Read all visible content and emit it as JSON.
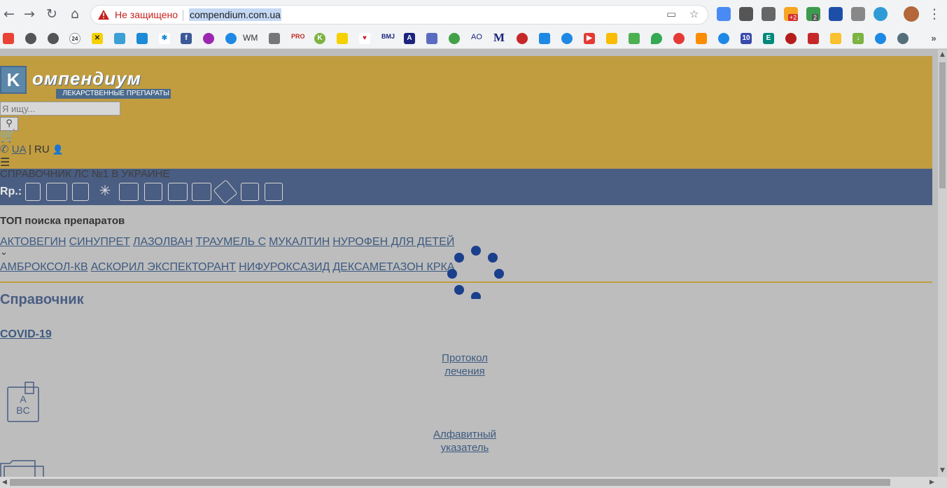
{
  "browser": {
    "not_secure_label": "Не защищено",
    "url": "compendium.com.ua",
    "bookmark_wm": "WM",
    "bookmark_pro": "PRO",
    "bookmark_bmj": "BMJ",
    "bookmark_ao": "AO",
    "bookmark_m": "M",
    "ext_badge_1": "+2",
    "ext_badge_2": "2",
    "bookmark_10": "10"
  },
  "header": {
    "logo_letter": "K",
    "logo_word": "омпендиум",
    "logo_subtitle": "ЛЕКАРСТВЕННЫЕ ПРЕПАРАТЫ",
    "search_placeholder": "Я ищу...",
    "lang_ua": "UA",
    "lang_sep": "|",
    "lang_ru": "RU",
    "tagline": "СПРАВОЧНИК ЛС №1 В УКРАИНЕ",
    "rp_label": "Rp.:"
  },
  "top_search": {
    "title": "ТОП поиска препаратов",
    "row1": [
      "АКТОВЕГИН",
      "СИНУПРЕТ",
      "ЛАЗОЛВАН",
      "ТРАУМЕЛЬ С",
      "МУКАЛТИН",
      "НУРОФЕН ДЛЯ ДЕТЕЙ"
    ],
    "row2": [
      "АМБРОКСОЛ-КВ",
      "АСКОРИЛ ЭКСПЕКТОРАНТ",
      "НИФУРОКСАЗИД",
      "ДЕКСАМЕТАЗОН КРКА"
    ]
  },
  "reference": {
    "title": "Справочник",
    "covid": "COVID-19",
    "protocol_line1": "Протокол",
    "protocol_line2": "лечения",
    "alpha_line1": "Алфавитный",
    "alpha_line2": "указатель"
  },
  "colors": {
    "header_gold": "#c19d40",
    "header_blue": "#4a5d82",
    "link": "#3d5a80",
    "spinner": "#1a3f8c"
  }
}
